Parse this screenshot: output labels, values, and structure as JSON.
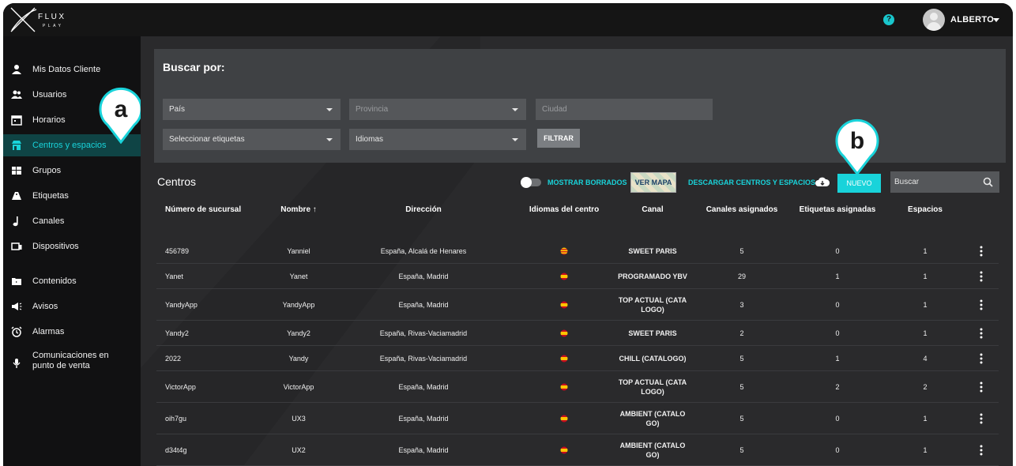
{
  "app": {
    "logo_text": "FLUX",
    "logo_subtext": "PLAY",
    "username": "ALBERTO",
    "help_glyph": "?"
  },
  "sidebar": {
    "items": [
      {
        "label": "Mis Datos Cliente",
        "icon": "person-icon"
      },
      {
        "label": "Usuarios",
        "icon": "users-icon"
      },
      {
        "label": "Horarios",
        "icon": "calendar-icon"
      },
      {
        "label": "Centros y espacios",
        "icon": "store-icon",
        "active": true
      },
      {
        "label": "Grupos",
        "icon": "grid-icon"
      },
      {
        "label": "Etiquetas",
        "icon": "tag-icon"
      },
      {
        "label": "Canales",
        "icon": "music-note-icon"
      },
      {
        "label": "Dispositivos",
        "icon": "devices-icon"
      },
      {
        "label": "Contenidos",
        "icon": "folder-icon"
      },
      {
        "label": "Avisos",
        "icon": "megaphone-icon"
      },
      {
        "label": "Alarmas",
        "icon": "alarm-icon"
      },
      {
        "label": "Comunicaciones en punto de venta",
        "icon": "microphone-icon"
      }
    ]
  },
  "search": {
    "title": "Buscar por:",
    "pais": "País",
    "provincia": "Provincia",
    "ciudad": "Ciudad",
    "etiquetas": "Seleccionar etiquetas",
    "idiomas": "Idiomas",
    "filtrar": "FILTRAR"
  },
  "centros": {
    "title": "Centros",
    "mostrar_borrados": "MOSTRAR BORRADOS",
    "ver_mapa": "VER MAPA",
    "descargar": "DESCARGAR CENTROS Y ESPACIOS",
    "nuevo": "NUEVO",
    "buscar_placeholder": "Buscar"
  },
  "table": {
    "headers": [
      "Número de sucursal",
      "Nombre ↑",
      "Dirección",
      "Idiomas del centro",
      "Canal",
      "Canales asignados",
      "Etiquetas asignadas",
      "Espacios"
    ],
    "rows": [
      {
        "sucursal": "456789",
        "nombre": "Yanniel",
        "direccion": "España, Alcalá de Henares",
        "idioma": "catalan",
        "canal": "SWEET PARIS",
        "canales": "5",
        "etiquetas": "0",
        "espacios": "1"
      },
      {
        "sucursal": "Yanet",
        "nombre": "Yanet",
        "direccion": "España, Madrid",
        "idioma": "spanish",
        "canal": "PROGRAMADO YBV",
        "canales": "29",
        "etiquetas": "1",
        "espacios": "1"
      },
      {
        "sucursal": "YandyApp",
        "nombre": "YandyApp",
        "direccion": "España, Madrid",
        "idioma": "spanish",
        "canal": "TOP ACTUAL (CATA LOGO)",
        "canales": "3",
        "etiquetas": "0",
        "espacios": "1"
      },
      {
        "sucursal": "Yandy2",
        "nombre": "Yandy2",
        "direccion": "España, Rivas-Vaciamadrid",
        "idioma": "spanish",
        "canal": "SWEET PARIS",
        "canales": "2",
        "etiquetas": "0",
        "espacios": "1"
      },
      {
        "sucursal": "2022",
        "nombre": "Yandy",
        "direccion": "España, Rivas-Vaciamadrid",
        "idioma": "spanish",
        "canal": "CHILL (CATALOGO)",
        "canales": "5",
        "etiquetas": "1",
        "espacios": "4"
      },
      {
        "sucursal": "VictorApp",
        "nombre": "VictorApp",
        "direccion": "España, Madrid",
        "idioma": "spanish",
        "canal": "TOP ACTUAL (CATA LOGO)",
        "canales": "5",
        "etiquetas": "2",
        "espacios": "2"
      },
      {
        "sucursal": "oih7gu",
        "nombre": "UX3",
        "direccion": "España, Madrid",
        "idioma": "spanish",
        "canal": "AMBIENT (CATALO GO)",
        "canales": "5",
        "etiquetas": "0",
        "espacios": "1"
      },
      {
        "sucursal": "d34t4g",
        "nombre": "UX2",
        "direccion": "España, Madrid",
        "idioma": "spanish",
        "canal": "AMBIENT (CATALO GO)",
        "canales": "5",
        "etiquetas": "0",
        "espacios": "1"
      }
    ]
  },
  "callouts": {
    "a": "a",
    "b": "b"
  },
  "colors": {
    "accent": "#19d3da",
    "panel": "#3f4144",
    "sidebar": "#111112",
    "active_item": "#0f4445"
  }
}
